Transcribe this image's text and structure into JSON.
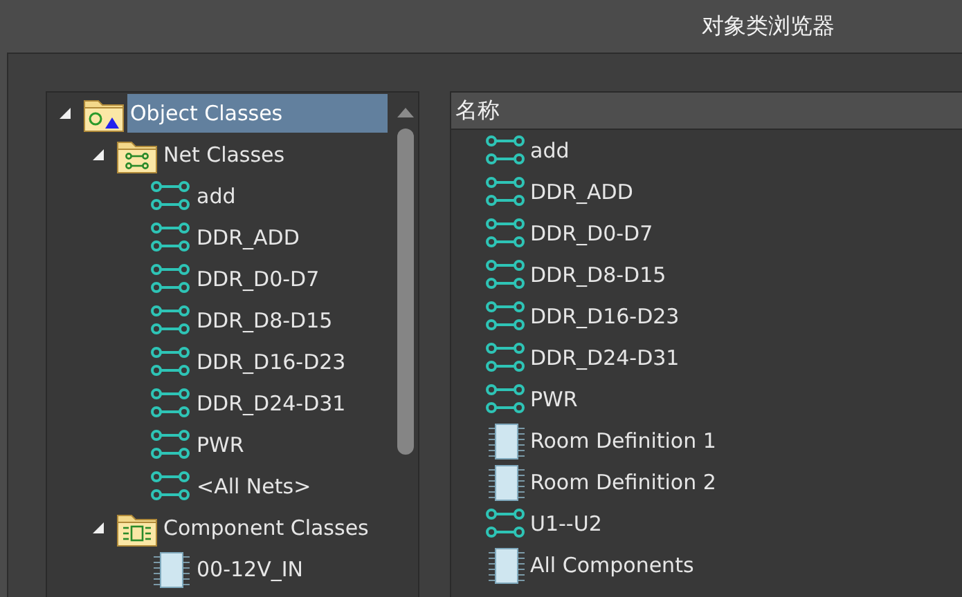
{
  "window": {
    "title": "对象类浏览器"
  },
  "tree": {
    "items": [
      {
        "label": "Object Classes",
        "kind": "root",
        "expanded": true,
        "selected": true,
        "children": [
          {
            "label": "Net Classes",
            "kind": "net-folder",
            "expanded": true,
            "selected": false,
            "children": [
              {
                "label": "add",
                "kind": "net",
                "selected": false
              },
              {
                "label": "DDR_ADD",
                "kind": "net",
                "selected": false
              },
              {
                "label": "DDR_D0-D7",
                "kind": "net",
                "selected": false
              },
              {
                "label": "DDR_D8-D15",
                "kind": "net",
                "selected": false
              },
              {
                "label": "DDR_D16-D23",
                "kind": "net",
                "selected": false
              },
              {
                "label": "DDR_D24-D31",
                "kind": "net",
                "selected": false
              },
              {
                "label": "PWR",
                "kind": "net",
                "selected": false
              },
              {
                "label": "<All Nets>",
                "kind": "net",
                "selected": false
              }
            ]
          },
          {
            "label": "Component Classes",
            "kind": "component-folder",
            "expanded": true,
            "selected": false,
            "children": [
              {
                "label": "00-12V_IN",
                "kind": "component",
                "selected": false
              }
            ]
          }
        ]
      }
    ]
  },
  "list": {
    "columns": [
      "名称"
    ],
    "rows": [
      {
        "name": "add",
        "kind": "net"
      },
      {
        "name": "DDR_ADD",
        "kind": "net"
      },
      {
        "name": "DDR_D0-D7",
        "kind": "net"
      },
      {
        "name": "DDR_D8-D15",
        "kind": "net"
      },
      {
        "name": "DDR_D16-D23",
        "kind": "net"
      },
      {
        "name": "DDR_D24-D31",
        "kind": "net"
      },
      {
        "name": "PWR",
        "kind": "net"
      },
      {
        "name": "Room Definition 1",
        "kind": "component"
      },
      {
        "name": "Room Definition 2",
        "kind": "component"
      },
      {
        "name": "U1--U2",
        "kind": "net"
      },
      {
        "name": "All Components",
        "kind": "component"
      }
    ]
  }
}
